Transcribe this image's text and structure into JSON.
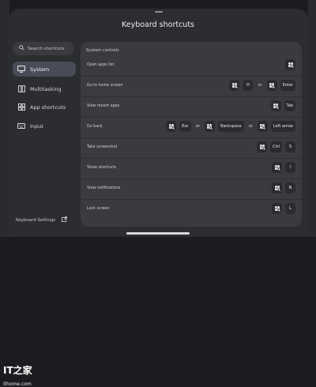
{
  "header": {
    "title": "Keyboard shortcuts"
  },
  "sidebar": {
    "search_placeholder": "Search shortcuts",
    "items": [
      {
        "label": "System",
        "icon": "monitor-icon",
        "active": true
      },
      {
        "label": "Multitasking",
        "icon": "multitask-icon",
        "active": false
      },
      {
        "label": "App shortcuts",
        "icon": "apps-icon",
        "active": false
      },
      {
        "label": "Input",
        "icon": "keyboard-icon",
        "active": false
      }
    ],
    "settings_label": "Keyboard Settings"
  },
  "section": {
    "title": "System controls",
    "rows": [
      {
        "label": "Open apps list",
        "keys": [
          "meta-icon"
        ]
      },
      {
        "label": "Go to home screen",
        "keys": [
          "meta-icon",
          "H",
          "or",
          "meta-icon",
          "Enter"
        ]
      },
      {
        "label": "View recent apps",
        "keys": [
          "meta-icon",
          "Tab"
        ]
      },
      {
        "label": "Go back",
        "keys": [
          "meta-icon",
          "Esc",
          "or",
          "meta-icon",
          "Backspace",
          "or",
          "meta-icon",
          "Left arrow"
        ]
      },
      {
        "label": "Take screenshot",
        "keys": [
          "meta-icon",
          "Ctrl",
          "S"
        ]
      },
      {
        "label": "Show shortcuts",
        "keys": [
          "meta-icon",
          "/"
        ]
      },
      {
        "label": "View notifications",
        "keys": [
          "meta-icon",
          "N"
        ]
      },
      {
        "label": "Lock screen",
        "keys": [
          "meta-icon",
          "L"
        ]
      }
    ]
  },
  "watermark": {
    "glyphs": "IT之家",
    "text": "ithome.com"
  },
  "colors": {
    "background": "#1b1c1f",
    "sheet": "#2c2d30",
    "panel": "#3a3b3f",
    "key": "#2a2b2e",
    "active": "#474c56"
  }
}
